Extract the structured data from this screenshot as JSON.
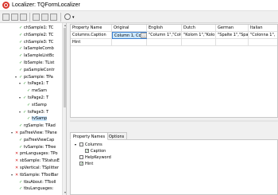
{
  "window": {
    "title": "Localizer: TQFormLocalizer"
  },
  "toolbar": {
    "buttons": [
      "new-icon",
      "open-icon",
      "save-icon",
      "cut-icon",
      "copy-icon",
      "paste-icon"
    ],
    "dropdown_icon": "globe-icon"
  },
  "tree": {
    "nodes": [
      {
        "label": "chSample1: TC",
        "check": "ok",
        "indent": 1
      },
      {
        "label": "chSample2: TC",
        "check": "ok",
        "indent": 1
      },
      {
        "label": "chSample3: TC",
        "check": "ok",
        "indent": 1
      },
      {
        "label": "laSampleComb",
        "check": "ok",
        "indent": 1
      },
      {
        "label": "laSampleListBc",
        "check": "ok",
        "indent": 1
      },
      {
        "label": "lbSample: TList",
        "check": "ok",
        "indent": 1
      },
      {
        "label": "paSampleContr",
        "check": "ok",
        "indent": 1
      },
      {
        "label": "pcSample: TPa",
        "check": "ok",
        "indent": 1,
        "expander": "▾"
      },
      {
        "label": "tsPage1: T",
        "check": "ok",
        "indent": 2,
        "expander": "▾"
      },
      {
        "label": "meSam",
        "check": "ok",
        "indent": 3
      },
      {
        "label": "tsPage2: T",
        "check": "ok",
        "indent": 2,
        "expander": "▾"
      },
      {
        "label": "stSamp",
        "check": "ok",
        "indent": 3
      },
      {
        "label": "tsPage3: T",
        "check": "ok",
        "indent": 2,
        "expander": "▾"
      },
      {
        "label": "tvSamp",
        "check": "ok",
        "indent": 3,
        "selected": true
      },
      {
        "label": "rgSample: TRad",
        "check": "ok",
        "indent": 1
      },
      {
        "label": "paTreeView: TPane",
        "check": "no",
        "indent": 0,
        "expander": "▾"
      },
      {
        "label": "paTreeViewCap",
        "check": "ok",
        "indent": 1
      },
      {
        "label": "tvSample: TTree",
        "check": "ok",
        "indent": 1
      },
      {
        "label": "pmLanguages: TPo",
        "check": "no",
        "indent": 0
      },
      {
        "label": "sbSample: TStatusE",
        "check": "no",
        "indent": 0
      },
      {
        "label": "spVertical: TSplitter",
        "check": "no",
        "indent": 0
      },
      {
        "label": "tbSample: TToolBar",
        "check": "no",
        "indent": 0,
        "expander": "▾"
      },
      {
        "label": "tbuAbout: TToolI",
        "check": "ok",
        "indent": 1
      },
      {
        "label": "tbuLanguages: ",
        "check": "ok",
        "indent": 1
      }
    ]
  },
  "grid": {
    "columns": [
      "Property Name",
      "Original",
      "English",
      "Dutch",
      "German",
      "Italian"
    ],
    "rows": [
      [
        "Columns.Caption",
        "Column 1, Colu",
        "\"Column 1\",\"Colu",
        "\"Kolom 1\",\"Kolo",
        "\"Spalte 1\",\"Spal",
        "\"Colonna 1\","
      ],
      [
        "Hint",
        "",
        "",
        "",
        "",
        ""
      ]
    ],
    "edit_button": "..."
  },
  "tabs": [
    "Property Names",
    "Options"
  ],
  "props": {
    "nodes": [
      {
        "label": "Columns",
        "indent": 0,
        "expander": "▾",
        "checked": false
      },
      {
        "label": "Caption",
        "indent": 1,
        "checked": true
      },
      {
        "label": "HelpKeyword",
        "indent": 0,
        "checked": false
      },
      {
        "label": "Hint",
        "indent": 0,
        "checked": true
      }
    ]
  }
}
